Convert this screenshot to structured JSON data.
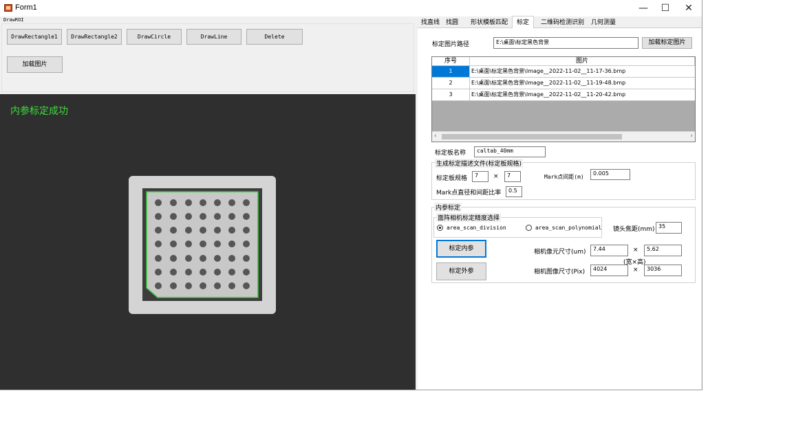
{
  "window": {
    "title": "Form1",
    "controls": {
      "minimize": "—",
      "maximize": "☐",
      "close": "✕"
    }
  },
  "left": {
    "section_label": "DrawROI",
    "buttons": [
      "DrawRectangle1",
      "DrawRectangle2",
      "DrawCircle",
      "DrawLine",
      "Delete"
    ],
    "load_image": "加载图片",
    "status_text": "内参标定成功",
    "status_color": "#3ddc3d"
  },
  "tabs": [
    "找直线",
    "找圆",
    "形状模板匹配",
    "标定",
    "二维码检测识别",
    "几何测量"
  ],
  "active_tab_index": 3,
  "calib": {
    "path_label": "标定图片路径",
    "path_value": "E:\\桌面\\标定黑色背景",
    "load_button": "加载标定图片",
    "grid": {
      "columns": [
        "序号",
        "图片"
      ],
      "rows": [
        {
          "num": "1",
          "path": "E:\\桌面\\标定黑色背景\\Image__2022-11-02__11-17-36.bmp"
        },
        {
          "num": "2",
          "path": "E:\\桌面\\标定黑色背景\\Image__2022-11-02__11-19-48.bmp"
        },
        {
          "num": "3",
          "path": "E:\\桌面\\标定黑色背景\\Image__2022-11-02__11-20-42.bmp"
        }
      ]
    },
    "board_name_label": "标定板名称",
    "board_name_value": "caltab_40mm",
    "gen_group": {
      "title": "生成标定描述文件(标定板规格)",
      "spec_label": "标定板规格",
      "spec_x": "7",
      "times": "×",
      "spec_y": "7",
      "mark_spacing_label": "Mark点间距(m)",
      "mark_spacing_value": "0.005",
      "ratio_label": "Mark点直径和间距比率",
      "ratio_value": "0.5"
    },
    "intrinsic_group": {
      "title": "内参标定",
      "cam_group_title": "面阵相机标定精度选择",
      "radio_division": "area_scan_division",
      "radio_polynomial": "area_scan_polynomial",
      "selected": "area_scan_division",
      "focal_label": "镜头焦距(mm)",
      "focal_value": "35",
      "btn_intrinsic": "标定内参",
      "btn_extrinsic": "标定外参",
      "pixel_size_label": "相机像元尺寸(um)",
      "pixel_w": "7.44",
      "times": "×",
      "pixel_h": "5.62",
      "wh_label": "(宽×高)",
      "image_size_label": "相机图像尺寸(Pix)",
      "image_w": "4024",
      "image_h": "3036"
    }
  }
}
